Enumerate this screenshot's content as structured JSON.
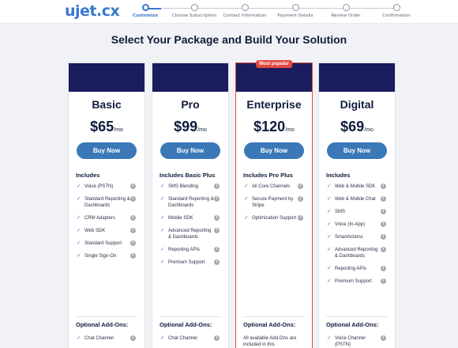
{
  "header": {
    "logo": "ujet.cx",
    "steps": [
      {
        "label": "Customize",
        "active": true
      },
      {
        "label": "Choose Subscription",
        "active": false
      },
      {
        "label": "Contact Information",
        "active": false
      },
      {
        "label": "Payment Details",
        "active": false
      },
      {
        "label": "Review Order",
        "active": false
      },
      {
        "label": "Confirmation",
        "active": false
      }
    ]
  },
  "page_title": "Select Your Package and Build Your Solution",
  "colors": {
    "accent": "#3a78b7",
    "navy": "#1a1c5e",
    "featured": "#e2473f",
    "background": "#f1f2f5"
  },
  "plans": [
    {
      "name": "Basic",
      "price": "$65",
      "per": "/mo",
      "button": "Buy Now",
      "includes_title": "Includes",
      "features": [
        "Voice (PSTN)",
        "Standard Reporting & Dashboards",
        "CRM Adapters",
        "Web SDK",
        "Standard Support",
        "Single Sign-On"
      ],
      "addons_title": "Optional Add-Ons:",
      "addons": [
        "Chat Channel"
      ]
    },
    {
      "name": "Pro",
      "price": "$99",
      "per": "/mo",
      "button": "Buy Now",
      "includes_title": "Includes Basic Plus",
      "features": [
        "SMS Blending",
        "Standard Reporting & Dashboards",
        "Mobile SDK",
        "Advanced Reporting & Dashboards",
        "Reporting APIs",
        "Premium Support"
      ],
      "addons_title": "Optional Add-Ons:",
      "addons": [
        "Chat Channel"
      ]
    },
    {
      "name": "Enterprise",
      "price": "$120",
      "per": "/mo",
      "badge": "Most popular",
      "button": "Buy Now",
      "includes_title": "Includes Pro Plus",
      "features": [
        "All Core Channels",
        "Secure Payment by Stripe",
        "Optimization Support"
      ],
      "addons_title": "Optional Add-Ons:",
      "addons_note": "All available Add-Ons are included in this"
    },
    {
      "name": "Digital",
      "price": "$69",
      "per": "/mo",
      "button": "Buy Now",
      "includes_title": "Includes",
      "features": [
        "Web & Mobile SDK",
        "Web & Mobile Chat",
        "SMS",
        "Voice (In-App)",
        "SmartActions",
        "Advanced Reporting & Dashboards",
        "Reporting APIs",
        "Premium Support"
      ],
      "addons_title": "Optional Add-Ons:",
      "addons": [
        "Voice Channel (PSTN)"
      ]
    }
  ]
}
